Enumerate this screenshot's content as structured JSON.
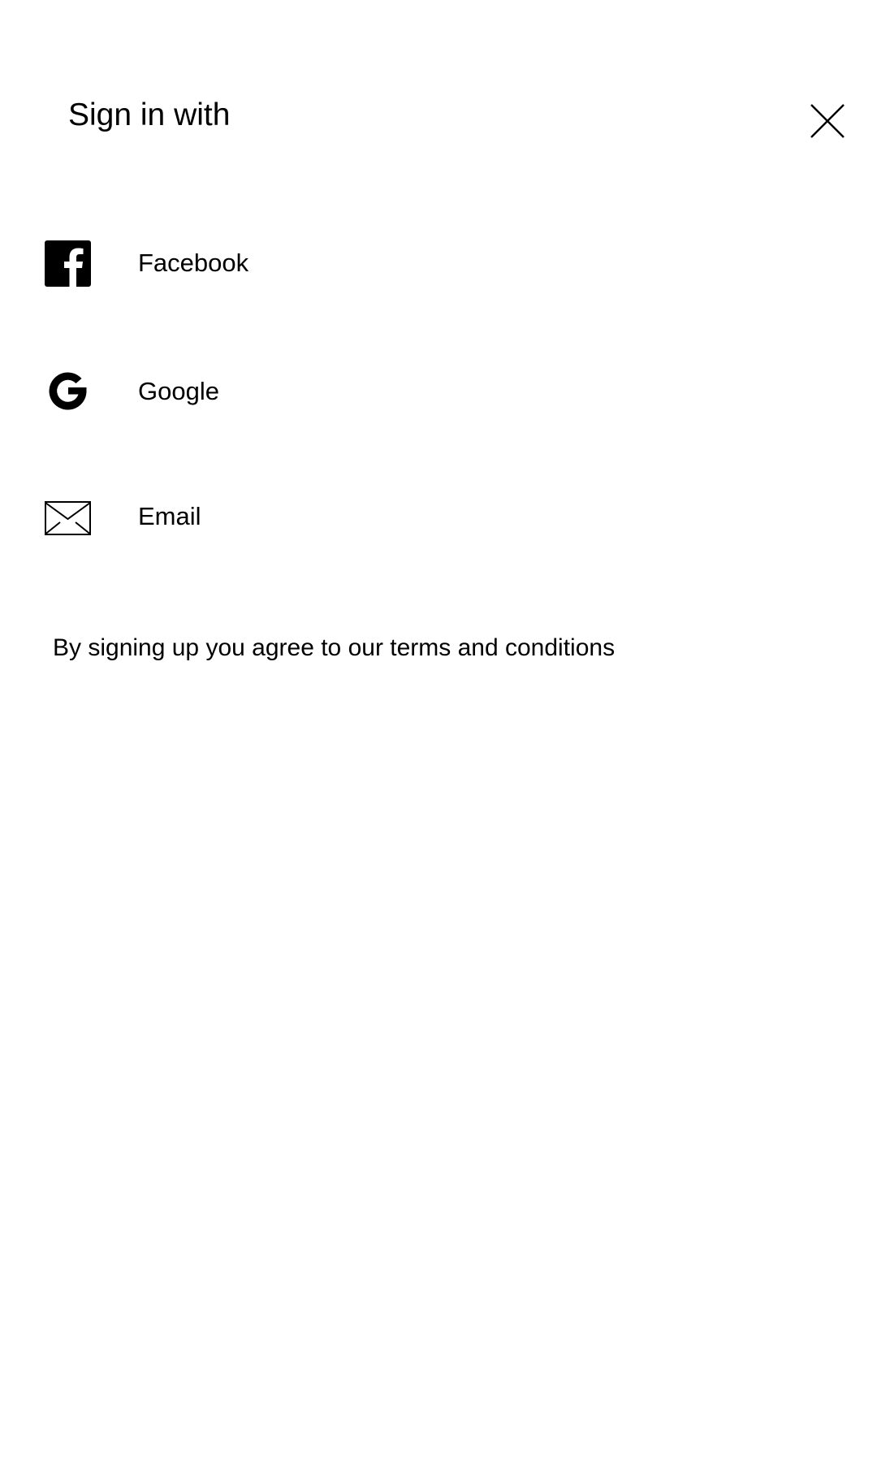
{
  "header": {
    "title": "Sign in with",
    "close_icon": "close-icon"
  },
  "options": [
    {
      "label": "Facebook",
      "icon": "facebook-icon"
    },
    {
      "label": "Google",
      "icon": "google-icon"
    },
    {
      "label": "Email",
      "icon": "envelope-icon"
    }
  ],
  "footer": {
    "terms_text": "By signing up you agree to our terms and conditions"
  },
  "colors": {
    "background": "#ffffff",
    "foreground": "#000000"
  }
}
